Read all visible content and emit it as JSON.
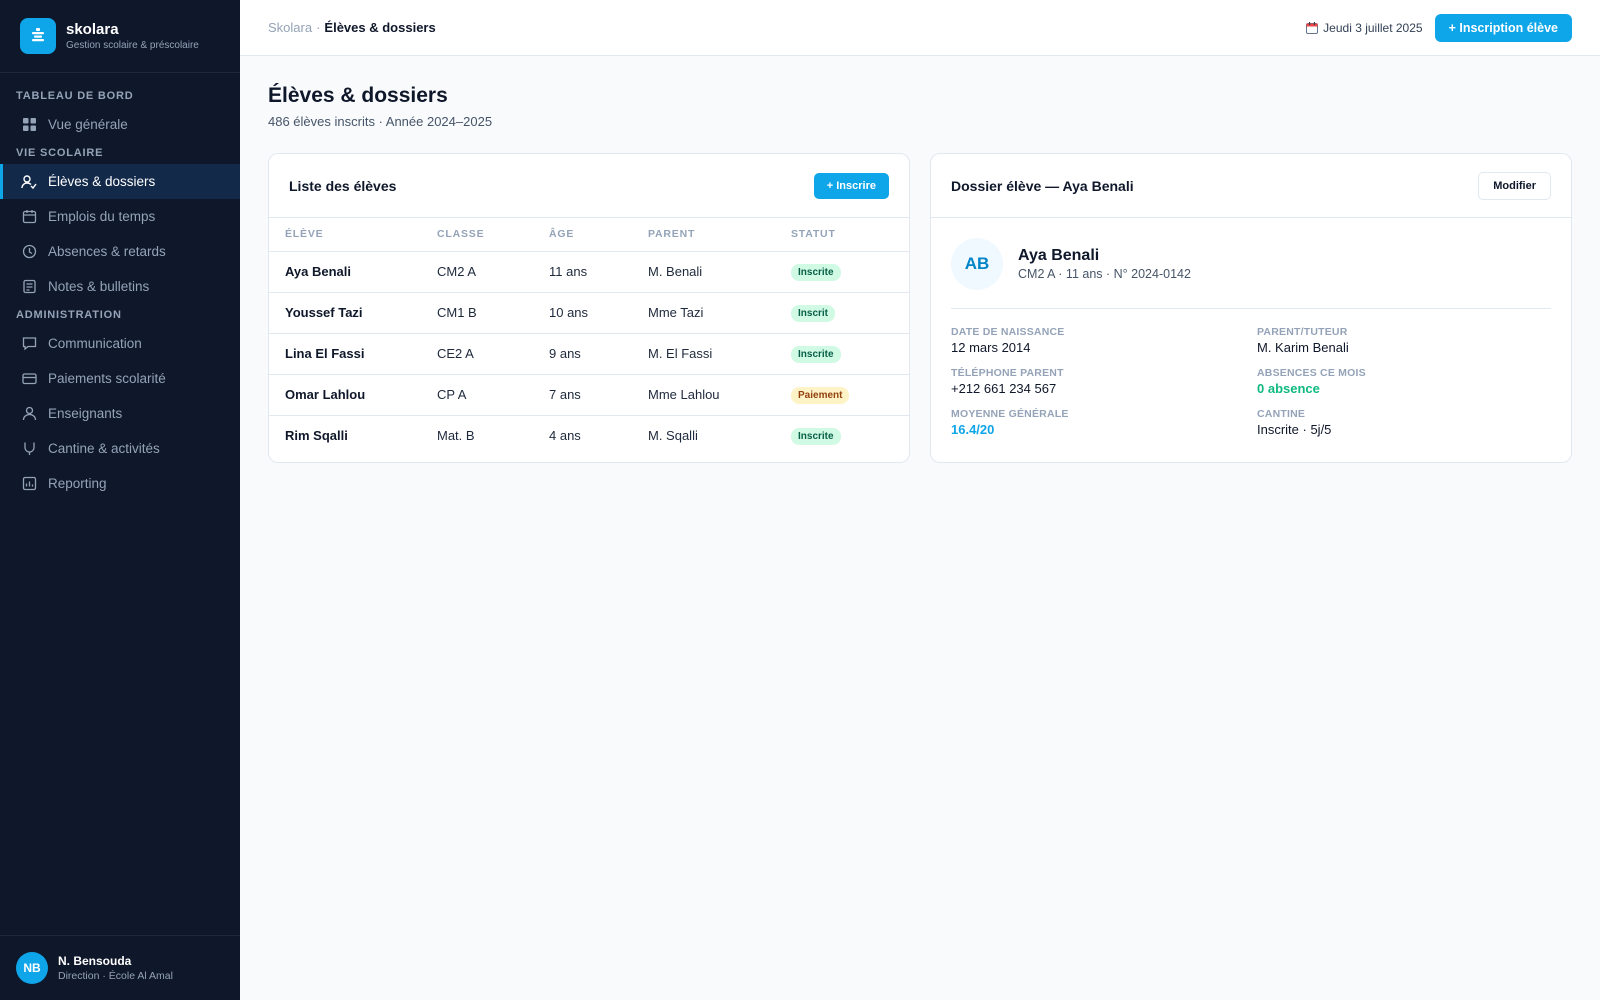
{
  "app": {
    "name": "skolara",
    "tagline": "Gestion scolaire & préscolaire"
  },
  "sidebar": {
    "sections": [
      {
        "title": "TABLEAU DE BORD",
        "items": [
          {
            "label": "Vue générale",
            "icon": "grid-icon"
          }
        ]
      },
      {
        "title": "VIE SCOLAIRE",
        "items": [
          {
            "label": "Élèves & dossiers",
            "icon": "user-check-icon",
            "active": true
          },
          {
            "label": "Emplois du temps",
            "icon": "calendar-icon"
          },
          {
            "label": "Absences & retards",
            "icon": "clock-icon"
          },
          {
            "label": "Notes & bulletins",
            "icon": "document-icon"
          }
        ]
      },
      {
        "title": "ADMINISTRATION",
        "items": [
          {
            "label": "Communication",
            "icon": "chat-icon"
          },
          {
            "label": "Paiements scolarité",
            "icon": "credit-card-icon"
          },
          {
            "label": "Enseignants",
            "icon": "user-icon"
          },
          {
            "label": "Cantine & activités",
            "icon": "utensils-icon"
          },
          {
            "label": "Reporting",
            "icon": "chart-icon"
          }
        ]
      }
    ],
    "user": {
      "initials": "NB",
      "name": "N. Bensouda",
      "role": "Direction · École Al Amal"
    }
  },
  "topbar": {
    "breadcrumb": {
      "root": "Skolara",
      "separator": "·",
      "current": "Élèves & dossiers"
    },
    "date": "Jeudi 3 juillet 2025",
    "date_icon": "calendar-emoji-icon",
    "primary_button": "+ Inscription élève"
  },
  "page": {
    "title": "Élèves & dossiers",
    "subtitle": "486 élèves inscrits · Année 2024–2025"
  },
  "student_list": {
    "title": "Liste des élèves",
    "button": "+ Inscrire",
    "columns": [
      "ÉLÈVE",
      "CLASSE",
      "ÂGE",
      "PARENT",
      "STATUT"
    ],
    "rows": [
      {
        "name": "Aya Benali",
        "class": "CM2 A",
        "age": "11 ans",
        "parent": "M. Benali",
        "status": "Inscrite",
        "status_type": "ok"
      },
      {
        "name": "Youssef Tazi",
        "class": "CM1 B",
        "age": "10 ans",
        "parent": "Mme Tazi",
        "status": "Inscrit",
        "status_type": "ok"
      },
      {
        "name": "Lina El Fassi",
        "class": "CE2 A",
        "age": "9 ans",
        "parent": "M. El Fassi",
        "status": "Inscrite",
        "status_type": "ok"
      },
      {
        "name": "Omar Lahlou",
        "class": "CP A",
        "age": "7 ans",
        "parent": "Mme Lahlou",
        "status": "Paiement",
        "status_type": "warn"
      },
      {
        "name": "Rim Sqalli",
        "class": "Mat. B",
        "age": "4 ans",
        "parent": "M. Sqalli",
        "status": "Inscrite",
        "status_type": "ok"
      }
    ]
  },
  "detail": {
    "title": "Dossier élève — Aya Benali",
    "button": "Modifier",
    "initials": "AB",
    "name": "Aya Benali",
    "meta": "CM2 A · 11 ans · N° 2024-0142",
    "fields": [
      {
        "label": "DATE DE NAISSANCE",
        "value": "12 mars 2014",
        "style": ""
      },
      {
        "label": "PARENT/TUTEUR",
        "value": "M. Karim Benali",
        "style": ""
      },
      {
        "label": "TÉLÉPHONE PARENT",
        "value": "+212 661 234 567",
        "style": ""
      },
      {
        "label": "ABSENCES CE MOIS",
        "value": "0 absence",
        "style": "green"
      },
      {
        "label": "MOYENNE GÉNÉRALE",
        "value": "16.4/20",
        "style": "blue"
      },
      {
        "label": "CANTINE",
        "value": "Inscrite · 5j/5",
        "style": ""
      }
    ]
  },
  "colors": {
    "accent": "#0ea5e9",
    "sidebar_bg": "#0f172a",
    "success": "#10b981",
    "warning": "#92400e"
  }
}
